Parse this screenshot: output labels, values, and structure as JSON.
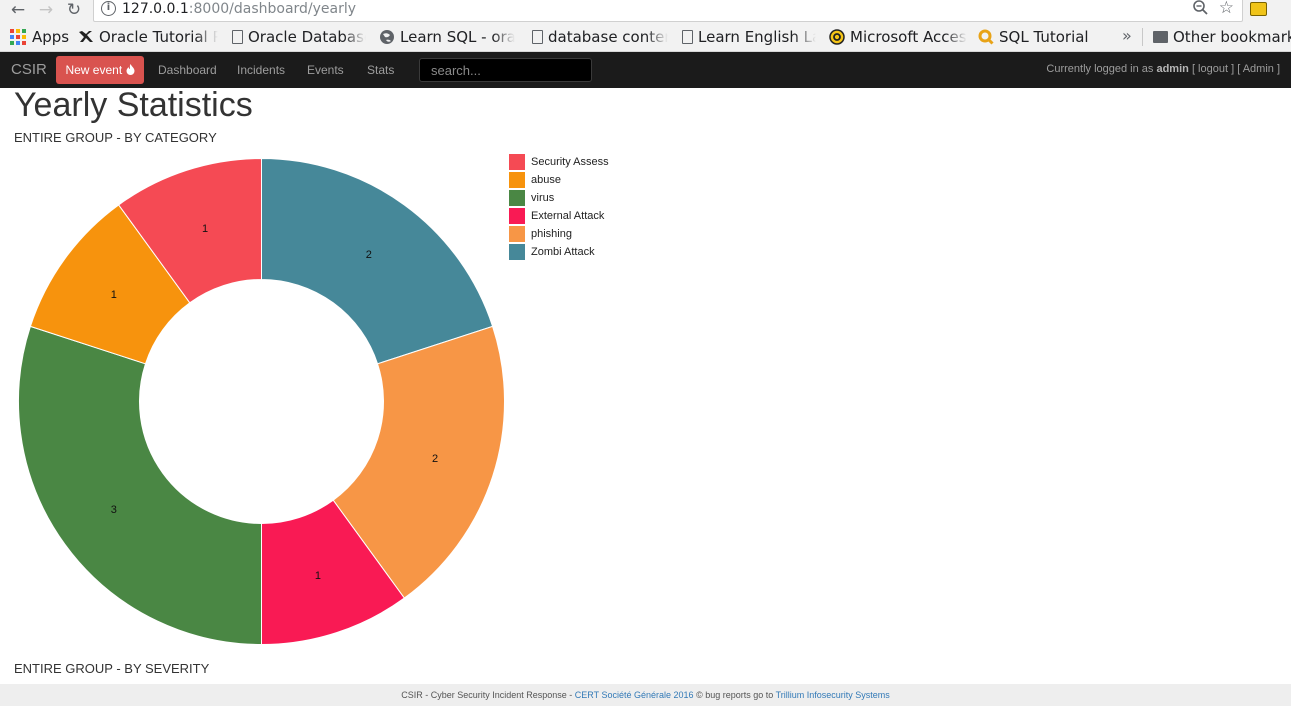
{
  "browser": {
    "url_host": "127.0.0.1",
    "url_path": ":8000/dashboard/yearly",
    "bookmarks": {
      "apps": "Apps",
      "items": [
        {
          "label": "Oracle Tutorial Pl"
        },
        {
          "label": "Oracle Database"
        },
        {
          "label": "Learn SQL - oracl"
        },
        {
          "label": "database content"
        },
        {
          "label": "Learn English La"
        },
        {
          "label": "Microsoft Access"
        },
        {
          "label": "SQL Tutorial"
        }
      ],
      "more": "»",
      "other": "Other bookmarks"
    }
  },
  "navbar": {
    "brand": "CSIR",
    "new_event": "New event",
    "links": [
      "Dashboard",
      "Incidents",
      "Events",
      "Stats"
    ],
    "search_placeholder": "search...",
    "login_prefix": "Currently logged in as",
    "user": "admin",
    "logout": "[ logout ]",
    "admin": "[ Admin ]"
  },
  "page": {
    "title": "Yearly Statistics",
    "section_category": "ENTIRE GROUP - BY CATEGORY",
    "section_severity": "ENTIRE GROUP - BY SEVERITY"
  },
  "chart_data": {
    "type": "pie",
    "donut": true,
    "categories": [
      "Zombi Attack",
      "phishing",
      "External Attack",
      "virus",
      "abuse",
      "Security Assess"
    ],
    "values": [
      2,
      2,
      1,
      3,
      1,
      1
    ],
    "colors": [
      "#468899",
      "#f79646",
      "#f91a54",
      "#4a8744",
      "#f7930d",
      "#f54a54"
    ],
    "legend": [
      "Security Assess",
      "abuse",
      "virus",
      "External Attack",
      "phishing",
      "Zombi Attack"
    ],
    "legend_colors": [
      "#f54a54",
      "#f7930d",
      "#4a8744",
      "#f91a54",
      "#f79646",
      "#468899"
    ],
    "legend_position": "right"
  },
  "footer": {
    "text": "CSIR - Cyber Security Incident Response -",
    "link1": "CERT Société Générale 2016",
    "middle": "© bug reports go to",
    "link2": "Trillium Infosecurity Systems"
  }
}
